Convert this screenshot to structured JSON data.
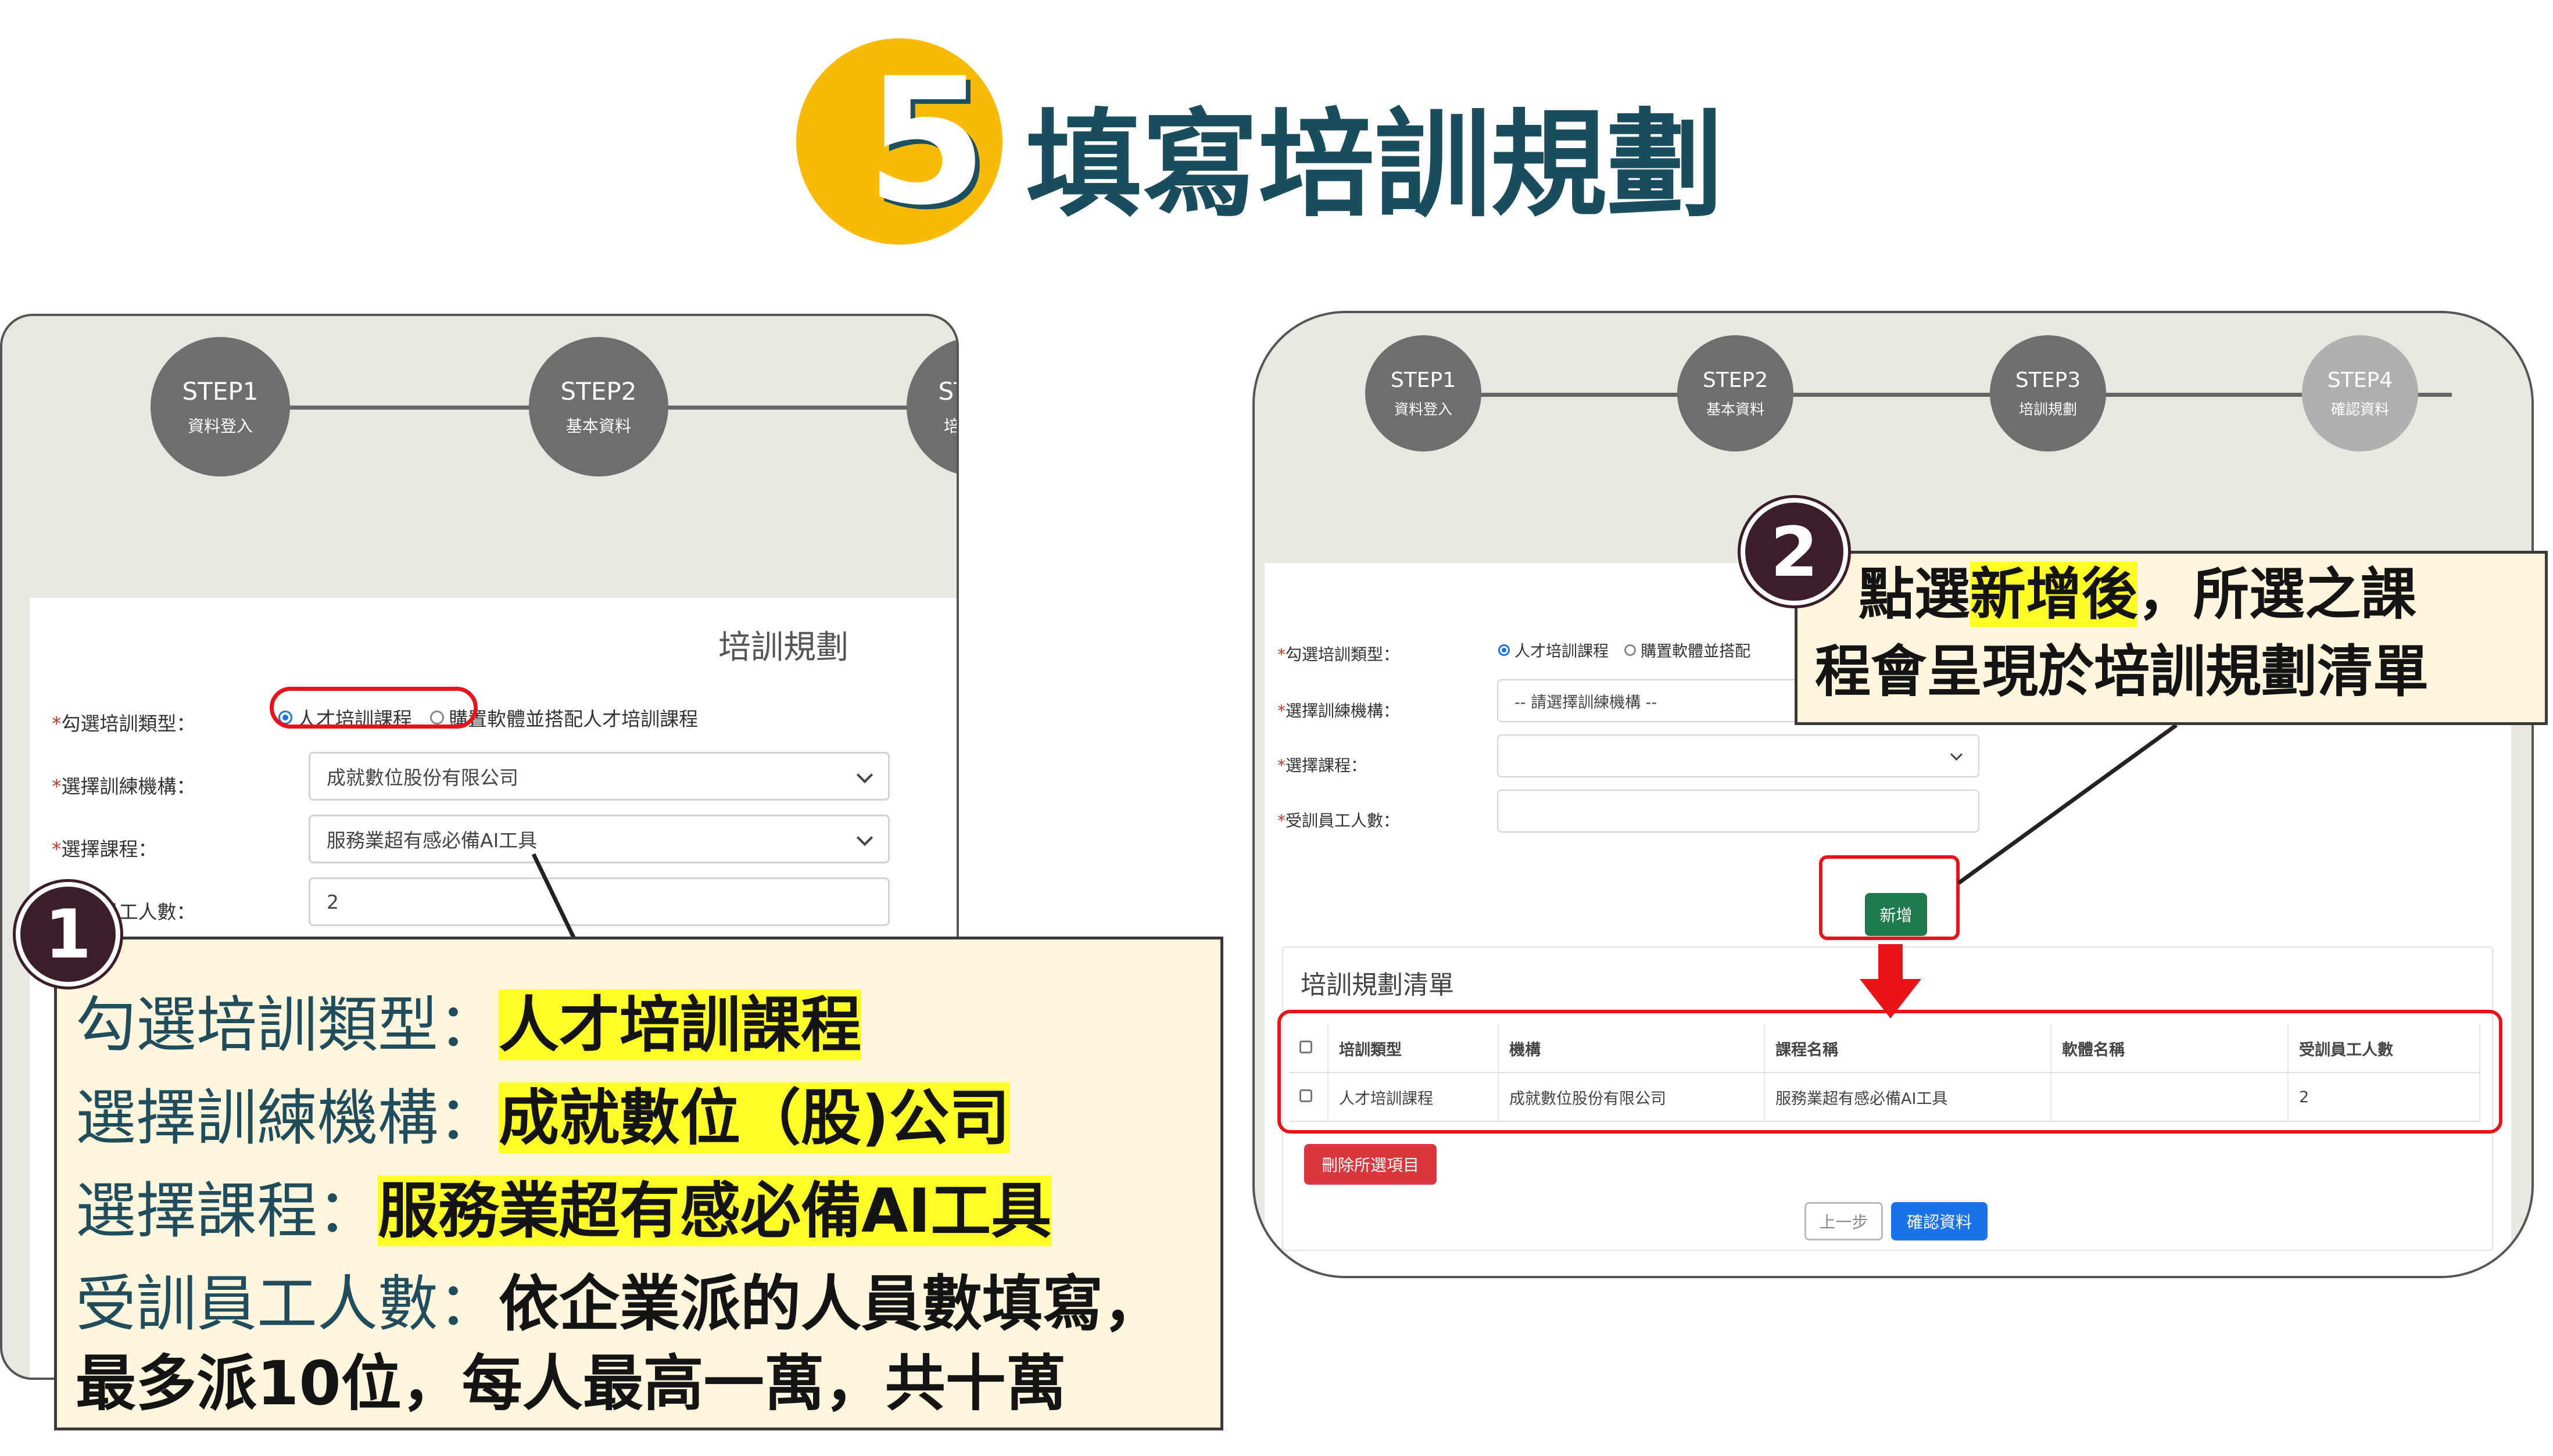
{
  "heading": {
    "step_number": "5",
    "title": "填寫培訓規劃"
  },
  "steps": [
    {
      "code": "STEP1",
      "name": "資料登入"
    },
    {
      "code": "STEP2",
      "name": "基本資料"
    },
    {
      "code": "STEP3",
      "name": "培訓規劃"
    },
    {
      "code": "STEP4",
      "name": "確認資料"
    }
  ],
  "left_form": {
    "card_title": "培訓規劃",
    "type_label": "勾選培訓類型：",
    "type_option_1": "人才培訓課程",
    "type_option_2": "購置軟體並搭配人才培訓課程",
    "org_label": "選擇訓練機構：",
    "org_value": "成就數位股份有限公司",
    "course_label": "選擇課程：",
    "course_value": "服務業超有感必備AI工具",
    "count_label": "受訓員工人數：",
    "count_value": "2"
  },
  "callout_1": {
    "badge": "1",
    "line1_key": "勾選培訓類型：",
    "line1_val": "人才培訓課程",
    "line2_key": "選擇訓練機構：",
    "line2_val": "成就數位（股)公司",
    "line3_key": "選擇課程：",
    "line3_val": "服務業超有感必備AI工具",
    "line4_key": "受訓員工人數：",
    "line4_val": "依企業派的人員數填寫，",
    "line5": "最多派10位，每人最高一萬，共十萬"
  },
  "right_form": {
    "type_label": "勾選培訓類型：",
    "type_option_1": "人才培訓課程",
    "type_option_2": "購置軟體並搭配",
    "org_label": "選擇訓練機構：",
    "org_placeholder": "-- 請選擇訓練機構 --",
    "course_label": "選擇課程：",
    "count_label": "受訓員工人數：",
    "add_button": "新增",
    "list_title": "培訓規劃清單",
    "table_headers": [
      "培訓類型",
      "機構",
      "課程名稱",
      "軟體名稱",
      "受訓員工人數"
    ],
    "table_rows": [
      {
        "type": "人才培訓課程",
        "org": "成就數位股份有限公司",
        "course": "服務業超有感必備AI工具",
        "software": "",
        "count": "2"
      }
    ],
    "delete_button": "刪除所選項目",
    "prev_button": "上一步",
    "confirm_button": "確認資料"
  },
  "callout_2": {
    "badge": "2",
    "text_a": "點選",
    "text_hl": "新增後",
    "text_b": "，所選之課",
    "text_line2": "程會呈現於培訓規劃清單"
  },
  "colors": {
    "accent_yellow": "#f8bb0a",
    "title_teal": "#1a4d5d",
    "highlight": "#fffb27",
    "annotation_red": "#e8141a",
    "add_green": "#1f7a4d",
    "delete_red": "#d9363e",
    "confirm_blue": "#1a73e8"
  }
}
